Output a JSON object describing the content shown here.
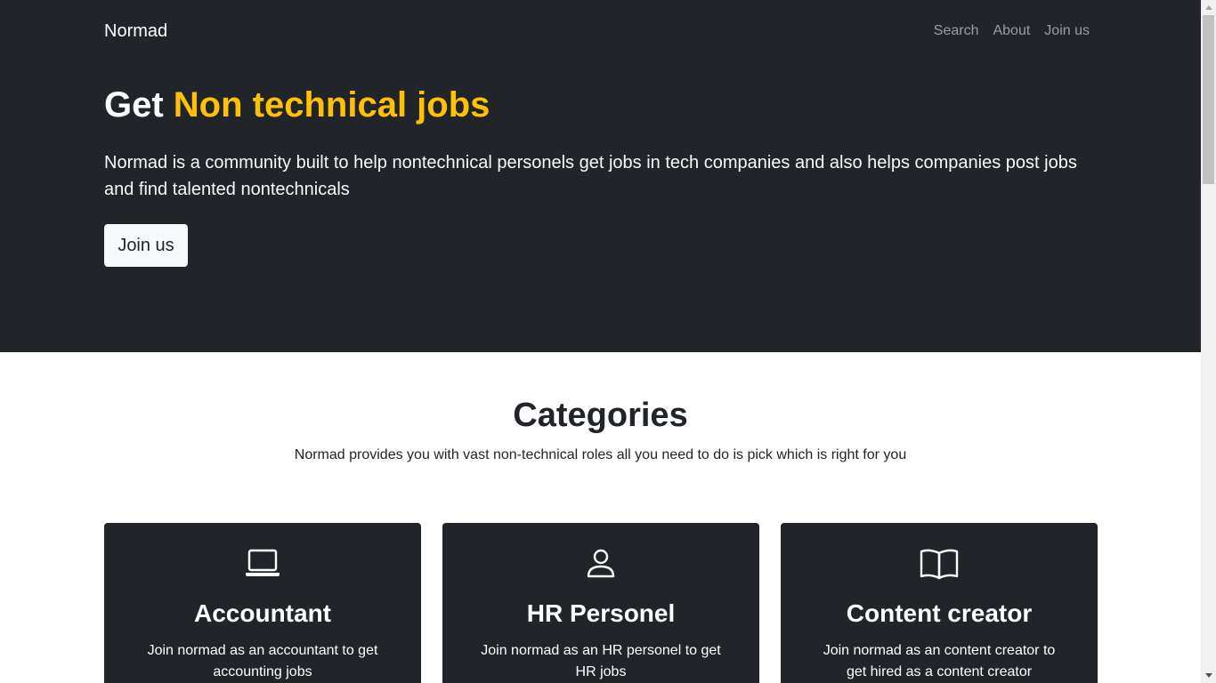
{
  "nav": {
    "brand": "Normad",
    "links": [
      "Search",
      "About",
      "Join us"
    ]
  },
  "hero": {
    "title_prefix": "Get ",
    "title_accent": "Non technical jobs",
    "lead": "Normad is a community built to help nontechnical personels get jobs in tech companies and also helps companies post jobs and find talented nontechnicals",
    "button_label": "Join us"
  },
  "categories": {
    "title": "Categories",
    "subtitle": "Normad provides you with vast non-technical roles all you need to do is pick which is right for you",
    "cards": [
      {
        "icon": "laptop-icon",
        "title": "Accountant",
        "text": "Join normad as an accountant to get accounting jobs"
      },
      {
        "icon": "person-icon",
        "title": "HR Personel",
        "text": "Join normad as an HR personel to get HR jobs"
      },
      {
        "icon": "book-icon",
        "title": "Content creator",
        "text": "Join normad as an content creator to get hired as a content creator"
      }
    ]
  },
  "colors": {
    "dark": "#212529",
    "accent": "#ffc107",
    "light": "#f8f9fa"
  }
}
